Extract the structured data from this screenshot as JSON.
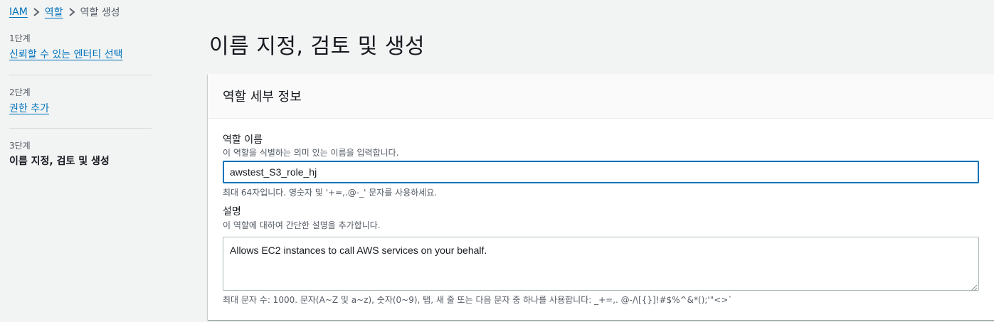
{
  "breadcrumb": {
    "items": [
      "IAM",
      "역할"
    ],
    "current": "역할 생성"
  },
  "steps": [
    {
      "number": "1단계",
      "label": "신뢰할 수 있는 엔터티 선택"
    },
    {
      "number": "2단계",
      "label": "권한 추가"
    },
    {
      "number": "3단계",
      "label": "이름 지정, 검토 및 생성"
    }
  ],
  "page": {
    "title": "이름 지정, 검토 및 생성"
  },
  "panel": {
    "title": "역할 세부 정보",
    "role_name": {
      "label": "역할 이름",
      "description": "이 역할을 식별하는 의미 있는 이름을 입력합니다.",
      "value": "awstest_S3_role_hj",
      "constraint": "최대 64자입니다. 영숫자 및 '+=,.@-_' 문자를 사용하세요."
    },
    "role_desc": {
      "label": "설명",
      "description": "이 역할에 대하여 간단한 설명을 추가합니다.",
      "value": "Allows EC2 instances to call AWS services on your behalf.",
      "constraint": "최대 문자 수: 1000. 문자(A~Z 및 a~z), 숫자(0~9), 탭, 새 줄 또는 다음 문자 중 하나를 사용합니다: _+=,. @-/\\[{}]!#$%^&*();'\"<>`"
    }
  },
  "colors": {
    "link": "#0073bb",
    "focus_border": "#0073bb",
    "background": "#f2f3f3"
  },
  "icons": [
    "chevron-right-icon",
    "resize-handle-icon"
  ]
}
